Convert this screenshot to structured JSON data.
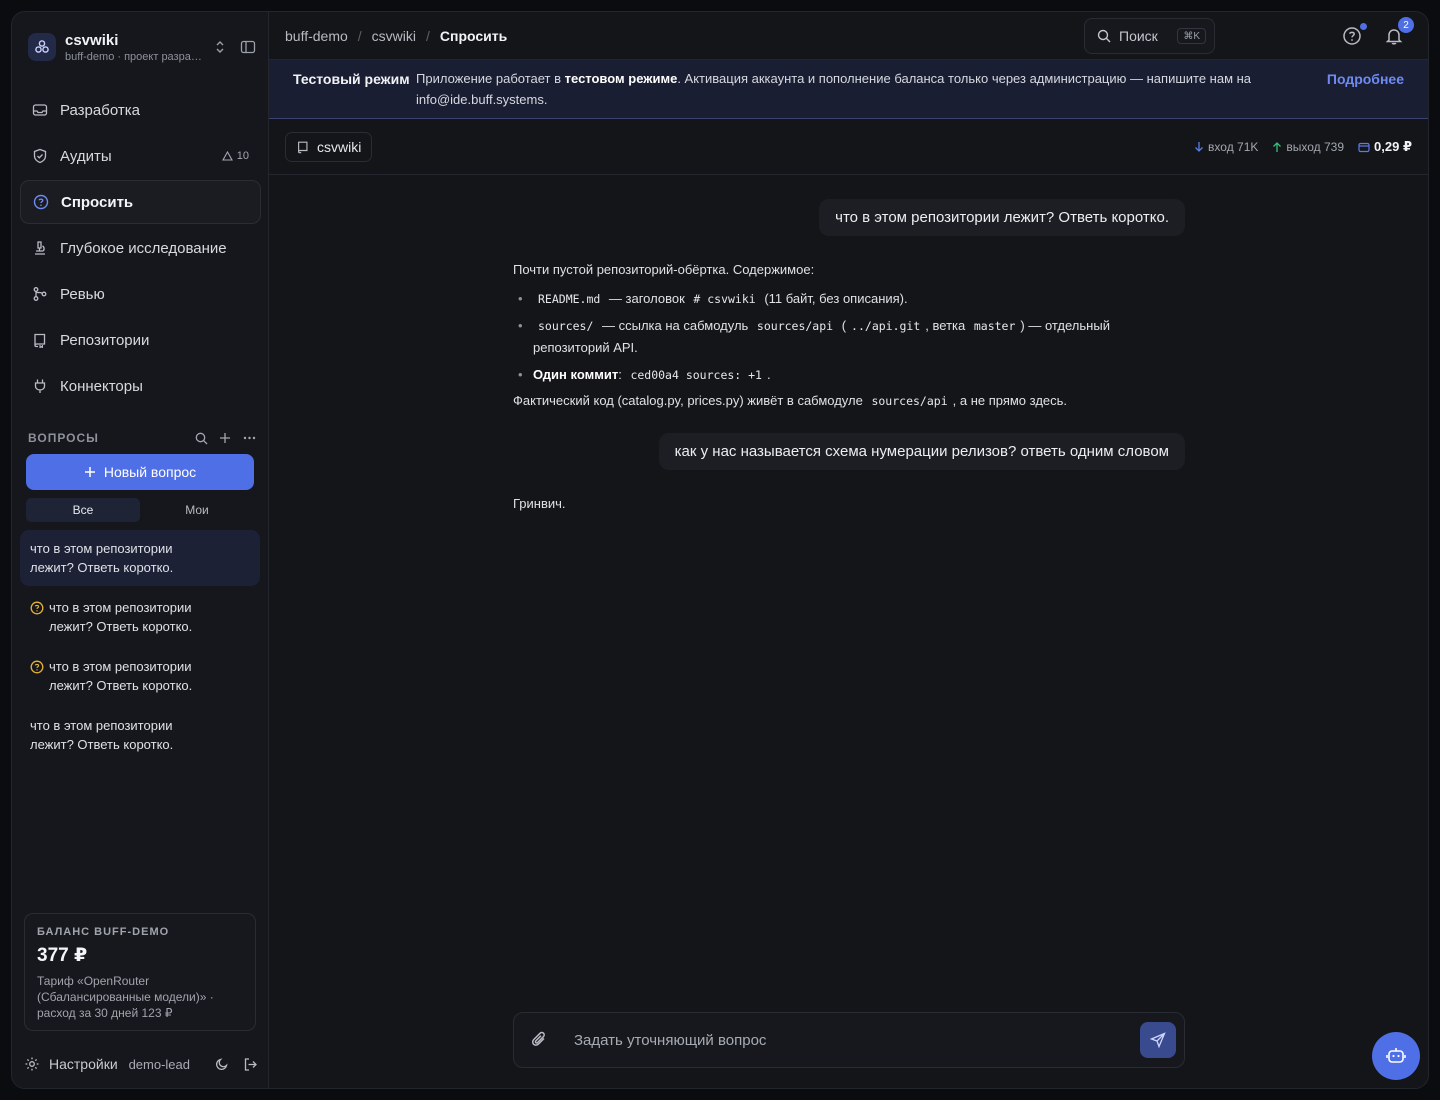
{
  "workspace": {
    "name": "csvwiki",
    "subtitle": "buff-demo · проект разработки"
  },
  "nav": [
    {
      "label": "Разработка",
      "icon": "inbox-icon"
    },
    {
      "label": "Аудиты",
      "icon": "shield-icon",
      "badge": "10"
    },
    {
      "label": "Спросить",
      "icon": "question-circle-icon",
      "active": true
    },
    {
      "label": "Глубокое исследование",
      "icon": "microscope-icon"
    },
    {
      "label": "Ревью",
      "icon": "git-branch-icon"
    },
    {
      "label": "Репозитории",
      "icon": "repo-icon"
    },
    {
      "label": "Коннекторы",
      "icon": "plug-icon"
    }
  ],
  "questions": {
    "title": "ВОПРОСЫ",
    "new_label": "Новый вопрос",
    "filters": [
      "Все",
      "Мои"
    ],
    "items": [
      {
        "text": "что в этом репозитории лежит? Ответь коротко.",
        "selected": true,
        "warn": false
      },
      {
        "text": "что в этом репозитории лежит? Ответь коротко.",
        "selected": false,
        "warn": true
      },
      {
        "text": "что в этом репозитории лежит? Ответь коротко.",
        "selected": false,
        "warn": true
      },
      {
        "text": "что в этом репозитории лежит? Ответь коротко.",
        "selected": false,
        "warn": false
      }
    ]
  },
  "balance": {
    "label": "БАЛАНС BUFF-DEMO",
    "amount": "377 ₽",
    "note": "Тариф «OpenRouter (Сбалансированные модели)» · расход за 30 дней 123 ₽"
  },
  "footer": {
    "settings": "Настройки",
    "user": "demo-lead"
  },
  "breadcrumb": [
    "buff-demo",
    "csvwiki",
    "Спросить"
  ],
  "search": {
    "label": "Поиск",
    "shortcut": "⌘K"
  },
  "notifications": {
    "count": "2"
  },
  "banner": {
    "title": "Тестовый режим",
    "text_1": "Приложение работает в ",
    "text_bold": "тестовом режиме",
    "text_2": ". Активация аккаунта и пополнение баланса только через администрацию — напишите нам на info@ide.buff.systems.",
    "link": "Подробнее"
  },
  "context": {
    "repo": "csvwiki",
    "in_label": "вход 71K",
    "out_label": "выход 739",
    "cost": "0,29 ₽"
  },
  "chat": {
    "q1": "что в этом репозитории лежит? Ответь коротко.",
    "a1_intro": "Почти пустой репозиторий-обёртка. Содержимое:",
    "a1_b1_code1": "README.md",
    "a1_b1_t1": " — заголовок ",
    "a1_b1_code2": "# csvwiki",
    "a1_b1_t2": " (11 байт, без описания).",
    "a1_b2_code1": "sources/",
    "a1_b2_t1": " — ссылка на сабмодуль ",
    "a1_b2_code2": "sources/api",
    "a1_b2_t2": " (",
    "a1_b2_code3": "../api.git",
    "a1_b2_t3": ", ветка ",
    "a1_b2_code4": "master",
    "a1_b2_t4": ") — отдельный репозиторий API.",
    "a1_b3_bold": "Один коммит",
    "a1_b3_t1": ": ",
    "a1_b3_code": "ced00a4 sources: +1",
    "a1_b3_t2": ".",
    "a1_outro_1": "Фактический код (catalog.py, prices.py) живёт в сабмодуле ",
    "a1_outro_code": "sources/api",
    "a1_outro_2": ", а не прямо здесь.",
    "q2": "как у нас называется схема нумерации релизов? ответь одним словом",
    "a2": "Гринвич."
  },
  "composer": {
    "placeholder": "Задать уточняющий вопрос"
  },
  "colors": {
    "accent": "#4f6fe6",
    "warning": "#e2b33a"
  }
}
